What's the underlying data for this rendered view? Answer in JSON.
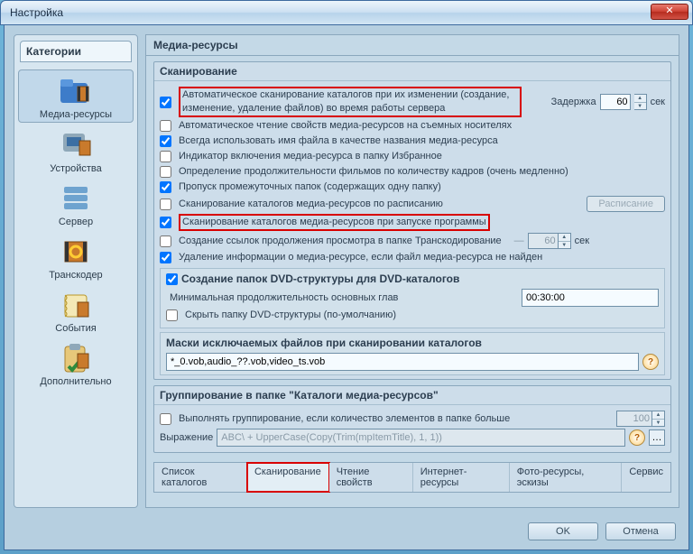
{
  "window": {
    "title": "Настройка",
    "close_glyph": "✕"
  },
  "sidebar": {
    "tab_label": "Категории",
    "items": [
      {
        "label": "Медиа-ресурсы"
      },
      {
        "label": "Устройства"
      },
      {
        "label": "Сервер"
      },
      {
        "label": "Транскодер"
      },
      {
        "label": "События"
      },
      {
        "label": "Дополнительно"
      }
    ]
  },
  "main": {
    "header": "Медиа-ресурсы",
    "scan_group_title": "Сканирование",
    "scan": {
      "opts": [
        "Автоматическое сканирование каталогов при их изменении (создание, изменение, удаление файлов) во время работы сервера",
        "Автоматическое чтение свойств медиа-ресурсов на съемных носителях",
        "Всегда использовать имя файла в качестве названия медиа-ресурса",
        "Индикатор включения медиа-ресурса в папку Избранное",
        "Определение продолжительности фильмов по количеству кадров (очень медленно)",
        "Пропуск промежуточных папок  (содержащих одну папку)",
        "Сканирование каталогов медиа-ресурсов по расписанию",
        "Сканирование каталогов медиа-ресурсов при запуске программы",
        "Создание ссылок продолжения просмотра в папке Транскодирование",
        "Удаление информации о медиа-ресурсе, если файл медиа-ресурса не найден"
      ],
      "checked": [
        true,
        false,
        true,
        false,
        false,
        true,
        false,
        true,
        false,
        true
      ],
      "delay_label": "Задержка",
      "delay_value": "60",
      "delay_unit": "сек",
      "schedule_btn": "Расписание",
      "unit_sec": "сек",
      "cont_val": "60"
    },
    "dvd": {
      "title": "Создание папок DVD-структуры для DVD-каталогов",
      "title_checked": true,
      "min_label": "Минимальная продолжительность основных глав",
      "min_value": "00:30:00",
      "hide_label": "Скрыть папку DVD-структуры  (по-умолчанию)",
      "hide_checked": false
    },
    "masks": {
      "title": "Маски исключаемых файлов  при сканировании каталогов",
      "value": "*_0.vob,audio_??.vob,video_ts.vob"
    },
    "grouping": {
      "title": "Группирование в папке \"Каталоги медиа-ресурсов\"",
      "enable_label": "Выполнять группирование, если количество элементов в папке больше",
      "enable_checked": false,
      "count": "100",
      "expr_label": "Выражение",
      "expr_value": "ABC\\ + UpperCase(Copy(Trim(mpItemTitle), 1, 1))"
    },
    "tabs": [
      "Список каталогов",
      "Сканирование",
      "Чтение свойств",
      "Интернет-ресурсы",
      "Фото-ресурсы, эскизы",
      "Сервис"
    ],
    "active_tab": 1
  },
  "footer": {
    "ok": "OK",
    "cancel": "Отмена"
  }
}
